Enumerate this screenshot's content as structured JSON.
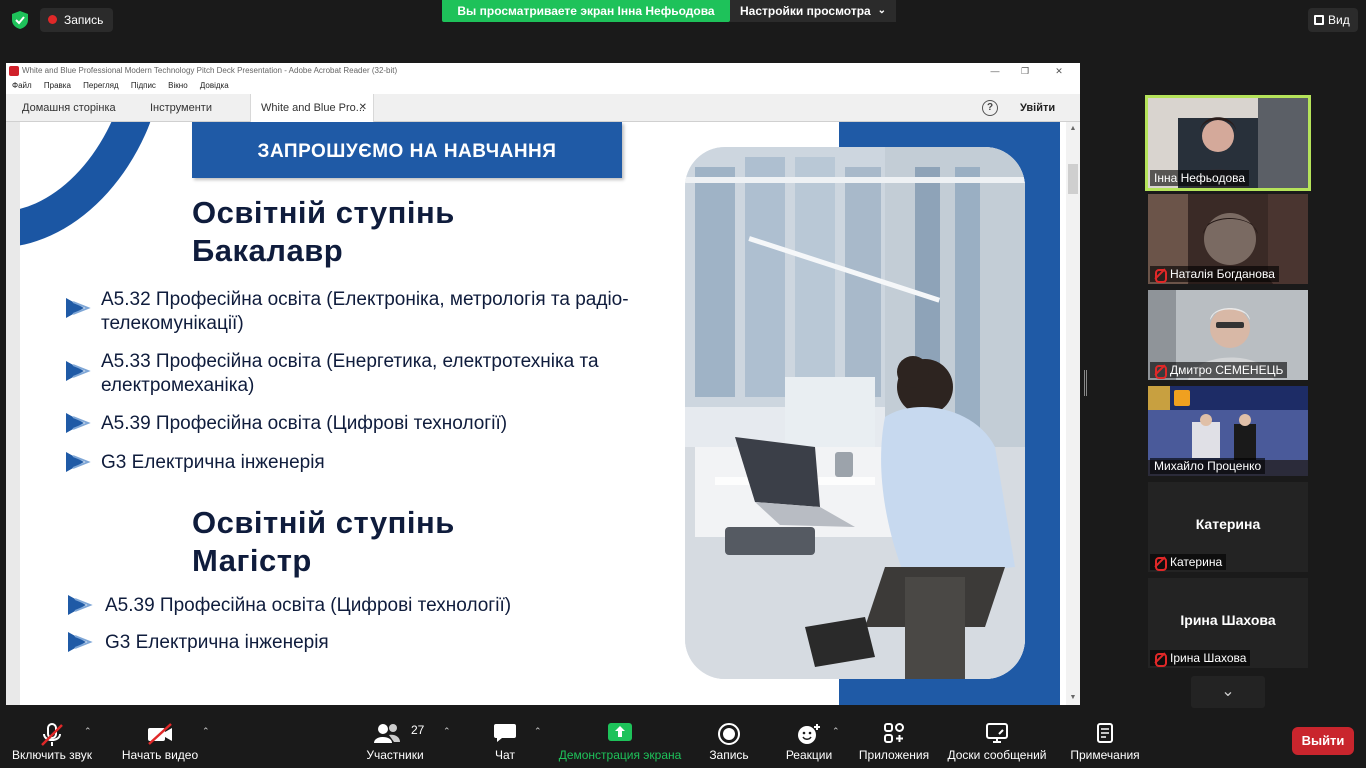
{
  "top": {
    "recording_label": "Запись",
    "share_banner": "Вы просматриваете экран Інна Нефьодова",
    "view_settings": "Настройки просмотра",
    "view_button": "Вид"
  },
  "acrobat": {
    "window_title": "White and Blue Professional Modern Technology Pitch Deck Presentation - Adobe Acrobat Reader (32-bit)",
    "menu": [
      "Файл",
      "Правка",
      "Перегляд",
      "Підпис",
      "Вікно",
      "Довідка"
    ],
    "tab_home": "Домашня сторінка",
    "tab_tools": "Інструменти",
    "tab_doc": "White and Blue Pro...",
    "login": "Увійти"
  },
  "slide": {
    "banner": "ЗАПРОШУЄМО НА НАВЧАННЯ",
    "bachelor_heading_1": "Освітній ступінь",
    "bachelor_heading_2": "Бакалавр",
    "bachelor_items": [
      [
        "А5.32 Професійна освіта (Електроніка, метрологія та радіо-",
        "телекомунікації)"
      ],
      [
        "А5.33 Професійна освіта (Енергетика, електротехніка та",
        "електромеханіка)"
      ],
      [
        "А5.39 Професійна освіта (Цифрові технології)"
      ],
      [
        "G3 Електрична інженерія"
      ]
    ],
    "master_heading_1": "Освітній ступінь",
    "master_heading_2": "Магістр",
    "master_items": [
      "А5.39 Професійна освіта (Цифрові технології)",
      "G3 Електрична інженерія"
    ]
  },
  "participants": [
    {
      "name": "Інна Нефьодова",
      "muted": false,
      "active": true
    },
    {
      "name": "Наталія Богданова",
      "muted": true
    },
    {
      "name": "Дмитро СЕМЕНЕЦЬ",
      "muted": true
    },
    {
      "name": "Михайло Проценко",
      "muted": false
    },
    {
      "name": "Катерина",
      "muted": true,
      "center_label": "Катерина"
    },
    {
      "name": "Ірина Шахова",
      "muted": true,
      "center_label": "Ірина Шахова"
    }
  ],
  "toolbar": {
    "unmute": "Включить звук",
    "start_video": "Начать видео",
    "participants": "Участники",
    "participants_count": "27",
    "chat": "Чат",
    "share": "Демонстрация экрана",
    "record": "Запись",
    "reactions": "Реакции",
    "apps": "Приложения",
    "whiteboards": "Доски сообщений",
    "notes": "Примечания",
    "leave": "Выйти"
  },
  "colors": {
    "share_green": "#1ec25a",
    "slide_blue": "#1f5aa6",
    "slide_text": "#0f1c3c",
    "active_speaker": "#b5e35a",
    "leave_red": "#c9252d"
  }
}
